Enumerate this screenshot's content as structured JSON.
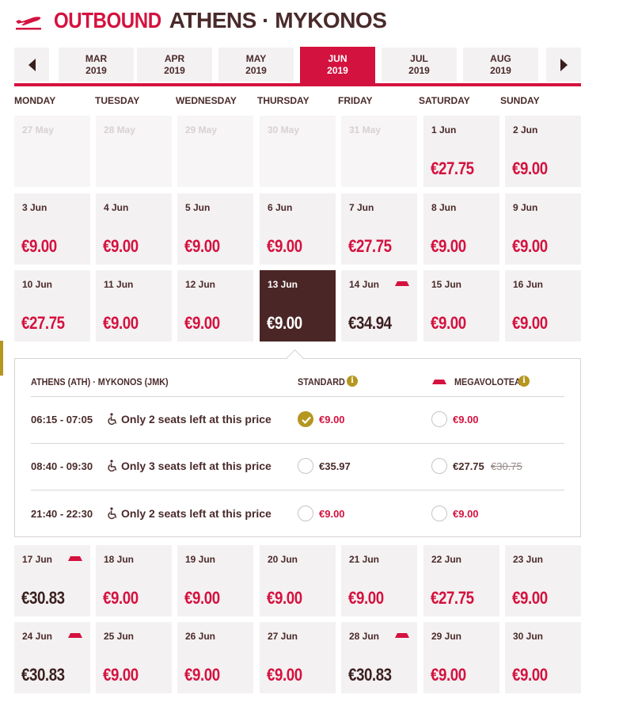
{
  "header": {
    "direction": "OUTBOUND",
    "route": "ATHENS · MYKONOS"
  },
  "month_nav": {
    "prev_icon": "chevron-left-icon",
    "next_icon": "chevron-right-icon",
    "months": [
      {
        "month": "MAR",
        "year": "2019"
      },
      {
        "month": "APR",
        "year": "2019"
      },
      {
        "month": "MAY",
        "year": "2019"
      },
      {
        "month": "JUN",
        "year": "2019"
      },
      {
        "month": "JUL",
        "year": "2019"
      },
      {
        "month": "AUG",
        "year": "2019"
      }
    ],
    "active_month": "JUN"
  },
  "weekdays": [
    "MONDAY",
    "TUESDAY",
    "WEDNESDAY",
    "THURSDAY",
    "FRIDAY",
    "SATURDAY",
    "SUNDAY"
  ],
  "calendar": {
    "row1": [
      {
        "label": "27 May",
        "price": ""
      },
      {
        "label": "28 May",
        "price": ""
      },
      {
        "label": "29 May",
        "price": ""
      },
      {
        "label": "30 May",
        "price": ""
      },
      {
        "label": "31 May",
        "price": ""
      },
      {
        "label": "1 Jun",
        "price": "€27.75"
      },
      {
        "label": "2 Jun",
        "price": "€9.00"
      }
    ],
    "row2": [
      {
        "label": "3 Jun",
        "price": "€9.00"
      },
      {
        "label": "4 Jun",
        "price": "€9.00"
      },
      {
        "label": "5 Jun",
        "price": "€9.00"
      },
      {
        "label": "6 Jun",
        "price": "€9.00"
      },
      {
        "label": "7 Jun",
        "price": "€27.75"
      },
      {
        "label": "8 Jun",
        "price": "€9.00"
      },
      {
        "label": "9 Jun",
        "price": "€9.00"
      }
    ],
    "row3": [
      {
        "label": "10 Jun",
        "price": "€27.75"
      },
      {
        "label": "11 Jun",
        "price": "€9.00"
      },
      {
        "label": "12 Jun",
        "price": "€9.00"
      },
      {
        "label": "13 Jun",
        "price": "€9.00"
      },
      {
        "label": "14 Jun",
        "price": "€34.94"
      },
      {
        "label": "15 Jun",
        "price": "€9.00"
      },
      {
        "label": "16 Jun",
        "price": "€9.00"
      }
    ],
    "row4": [
      {
        "label": "17 Jun",
        "price": "€30.83"
      },
      {
        "label": "18 Jun",
        "price": "€9.00"
      },
      {
        "label": "19 Jun",
        "price": "€9.00"
      },
      {
        "label": "20 Jun",
        "price": "€9.00"
      },
      {
        "label": "21 Jun",
        "price": "€9.00"
      },
      {
        "label": "22 Jun",
        "price": "€27.75"
      },
      {
        "label": "23 Jun",
        "price": "€9.00"
      }
    ],
    "row5": [
      {
        "label": "24 Jun",
        "price": "€30.83"
      },
      {
        "label": "25 Jun",
        "price": "€9.00"
      },
      {
        "label": "26 Jun",
        "price": "€9.00"
      },
      {
        "label": "27 Jun",
        "price": "€9.00"
      },
      {
        "label": "28 Jun",
        "price": "€30.83"
      },
      {
        "label": "29 Jun",
        "price": "€9.00"
      },
      {
        "label": "30 Jun",
        "price": "€9.00"
      }
    ],
    "selected_date": "13 Jun"
  },
  "flights_panel": {
    "route_label": "ATHENS (ATH) · MYKONOS (JMK)",
    "fare_standard": "STANDARD",
    "fare_mega": "MEGAVOLOTEA",
    "info_icon": "info-icon",
    "flights": [
      {
        "time": "06:15 - 07:05",
        "seats": "Only 2 seats left at this price",
        "standard_price": "€9.00",
        "mega_price": "€9.00",
        "mega_old_price": "",
        "standard_selected": true
      },
      {
        "time": "08:40 - 09:30",
        "seats": "Only 3 seats left at this price",
        "standard_price": "€35.97",
        "mega_price": "€27.75",
        "mega_old_price": "€30.75",
        "standard_selected": false
      },
      {
        "time": "21:40 - 22:30",
        "seats": "Only 2 seats left at this price",
        "standard_price": "€9.00",
        "mega_price": "€9.00",
        "mega_old_price": "",
        "standard_selected": false
      }
    ]
  },
  "colors": {
    "brand_red": "#d4123f",
    "dark_brown": "#4b2626",
    "gold": "#b5961f",
    "cell_bg": "#f4f1f2"
  }
}
